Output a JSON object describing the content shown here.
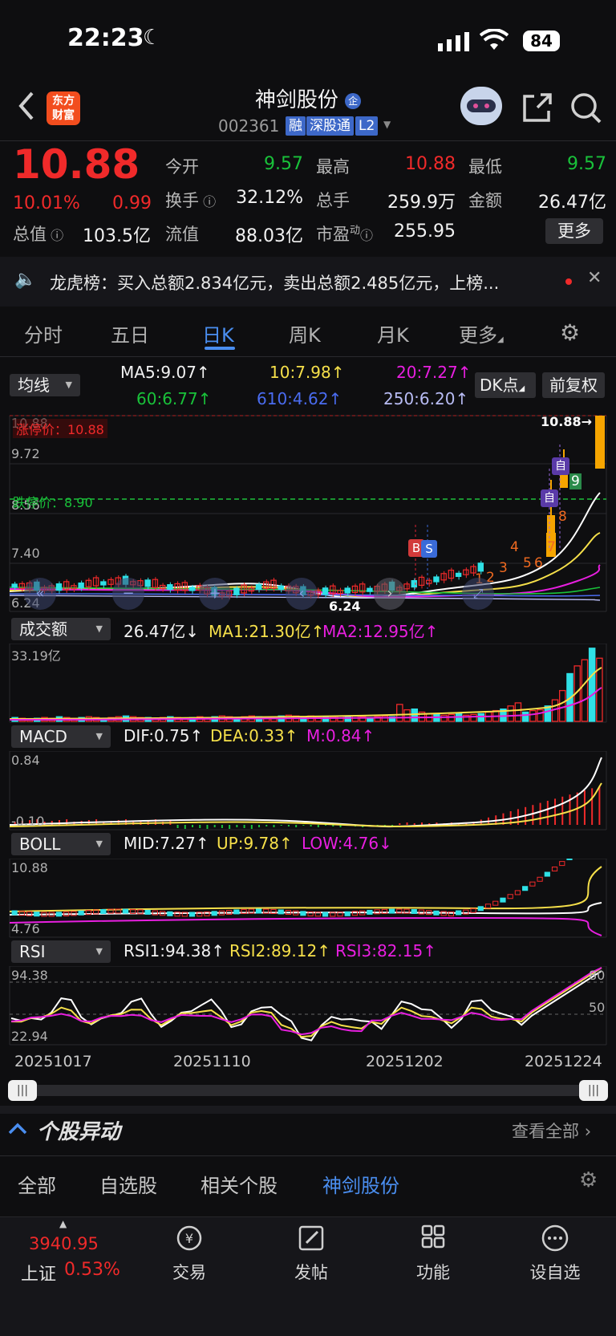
{
  "status_bar": {
    "time": "22:23",
    "battery": "84"
  },
  "header": {
    "logo_text": "东方\n财富",
    "stock_name": "神剑股份",
    "stock_code": "002361",
    "tags": [
      "融",
      "深股通",
      "L2"
    ]
  },
  "quote": {
    "price": "10.88",
    "change_pct": "10.01%",
    "change": "0.99",
    "open_label": "今开",
    "open": "9.57",
    "high_label": "最高",
    "high": "10.88",
    "low_label": "最低",
    "low": "9.57",
    "turnover_label": "换手",
    "turnover": "32.12%",
    "volume_label": "总手",
    "volume": "259.9万",
    "amount_label": "金额",
    "amount": "26.47亿",
    "market_cap_label": "总值",
    "market_cap": "103.5亿",
    "float_cap_label": "流值",
    "float_cap": "88.03亿",
    "pe_label": "市盈",
    "pe_sup": "动",
    "pe": "255.95",
    "more_button": "更多"
  },
  "notice": {
    "text": "龙虎榜：买入总额2.834亿元，卖出总额2.485亿元，上榜..."
  },
  "tabs": [
    "分时",
    "五日",
    "日K",
    "周K",
    "月K",
    "更多"
  ],
  "active_tab": "日K",
  "ma_bar": {
    "dropdown": "均线",
    "ma5": "MA5:9.07↑",
    "ma10": "10:7.98↑",
    "ma20": "20:7.27↑",
    "ma60": "60:6.77↑",
    "ma610": "610:4.62↑",
    "ma250": "250:6.20↑",
    "dk_button": "DK点",
    "adjust_button": "前复权"
  },
  "kline": {
    "y_labels": [
      "10.88",
      "9.72",
      "8.56",
      "7.40",
      "6.24"
    ],
    "limit_up_label": "涨停价：10.88",
    "limit_down_label": "跌停价：8.90",
    "last_price_label": "10.88",
    "low_marker": "6.24",
    "markers": [
      "B",
      "S",
      "自",
      "自",
      "1",
      "2",
      "3",
      "4",
      "5",
      "6",
      "7",
      "8",
      "9"
    ]
  },
  "volume": {
    "dropdown": "成交额",
    "value": "26.47亿↓",
    "ma1": "MA1:21.30亿↑",
    "ma2": "MA2:12.95亿↑",
    "y_max": "33.19亿",
    "bars": [
      0.05,
      0.04,
      0.03,
      0.04,
      0.05,
      0.04,
      0.06,
      0.05,
      0.04,
      0.05,
      0.06,
      0.05,
      0.04,
      0.05,
      0.06,
      0.07,
      0.06,
      0.05,
      0.05,
      0.04,
      0.05,
      0.06,
      0.05,
      0.04,
      0.05,
      0.06,
      0.05,
      0.06,
      0.07,
      0.06,
      0.05,
      0.06,
      0.07,
      0.06,
      0.05,
      0.06,
      0.07,
      0.08,
      0.07,
      0.06,
      0.07,
      0.06,
      0.05,
      0.06,
      0.07,
      0.06,
      0.07,
      0.06,
      0.05,
      0.06,
      0.07,
      0.06,
      0.22,
      0.15,
      0.16,
      0.12,
      0.1,
      0.09,
      0.08,
      0.09,
      0.1,
      0.08,
      0.09,
      0.1,
      0.12,
      0.14,
      0.16,
      0.2,
      0.24,
      0.12,
      0.14,
      0.15,
      0.2,
      0.28,
      0.4,
      0.62,
      0.72,
      0.8,
      0.95,
      0.82
    ]
  },
  "macd": {
    "dropdown": "MACD",
    "dif": "DIF:0.75↑",
    "dea": "DEA:0.33↑",
    "m": "M:0.84↑",
    "y_top": "0.84",
    "y_bottom": "-0.10"
  },
  "boll": {
    "dropdown": "BOLL",
    "mid": "MID:7.27↑",
    "up": "UP:9.78↑",
    "low": "LOW:4.76↓",
    "y_top": "10.88",
    "y_bottom": "4.76"
  },
  "rsi": {
    "dropdown": "RSI",
    "rsi1": "RSI1:94.38↑",
    "rsi2": "RSI2:89.12↑",
    "rsi3": "RSI3:82.15↑",
    "y_top": "94.38",
    "y_bottom": "22.94",
    "level_80": "80",
    "level_50": "50"
  },
  "dates": [
    "20251017",
    "20251110",
    "20251202",
    "20251224"
  ],
  "movement": {
    "title": "个股异动",
    "view_all": "查看全部"
  },
  "filters": [
    "全部",
    "自选股",
    "相关个股",
    "神剑股份"
  ],
  "active_filter": "神剑股份",
  "bottom_nav": {
    "index_value": "3940.95",
    "index_name": "上证",
    "index_change": "0.53%",
    "items": [
      "交易",
      "发帖",
      "功能",
      "设自选"
    ]
  },
  "colors": {
    "up": "#f02a2a",
    "down": "#19c23a",
    "accent": "#4a8ef0",
    "ma5": "#ffffff",
    "ma10": "#f6e04a",
    "ma20": "#e81fe0"
  }
}
